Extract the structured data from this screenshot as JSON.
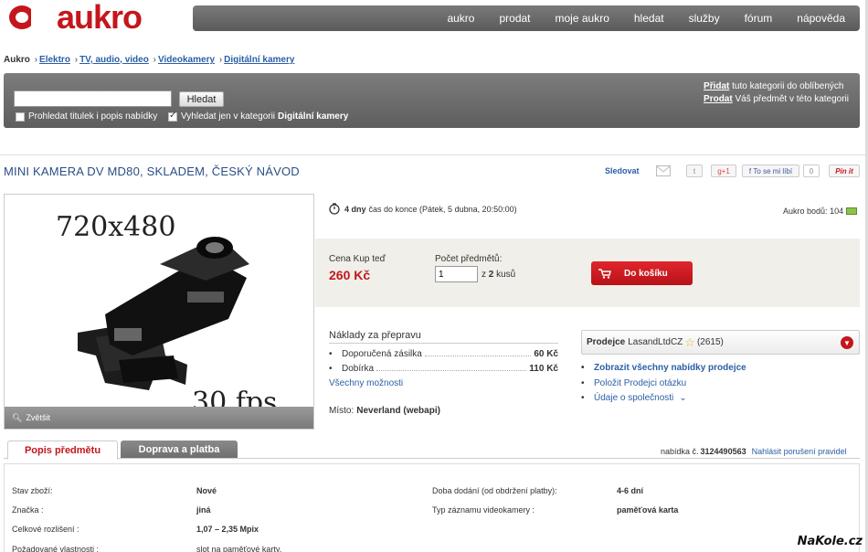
{
  "brand": {
    "logo_text": "aukro",
    "color": "#c4161c"
  },
  "topnav": [
    "aukro",
    "prodat",
    "moje aukro",
    "hledat",
    "služby",
    "fórum",
    "nápověda"
  ],
  "breadcrumb": {
    "root": "Aukro",
    "items": [
      "Elektro",
      "TV, audio, video",
      "Videokamery",
      "Digitální kamery"
    ]
  },
  "search": {
    "button": "Hledat",
    "option1": "Prohledat titulek i popis nabídky",
    "option2_prefix": "Vyhledat jen v kategorii",
    "option2_category": "Digitální kamery",
    "right_line1_link": "Přidat",
    "right_line1_text": "tuto kategorii do oblíbených",
    "right_line2_link": "Prodat",
    "right_line2_text": "Váš předmět v této kategorii"
  },
  "product": {
    "title": "MINI KAMERA DV MD80, SKLADEM, ČESKÝ NÁVOD",
    "follow": "Sledovat",
    "gplus": "+1",
    "like": "To se mi líbí",
    "like_count": "0",
    "pin": "Pin it",
    "image_text_top": "720x480",
    "image_text_bottom": "30 fps",
    "zoom": "Zvětšit"
  },
  "timer": {
    "days": "4 dny",
    "text": "čas do konce (Pátek, 5 dubna, 20:50:00)"
  },
  "points": {
    "label": "Aukro bodů:",
    "value": "104"
  },
  "buy": {
    "price_label": "Cena Kup teď",
    "price": "260 Kč",
    "qty_label": "Počet předmětů:",
    "qty_value": "1",
    "of_prefix": "z",
    "of_count": "2",
    "of_suffix": "kusů",
    "cart_button": "Do košíku"
  },
  "shipping": {
    "heading": "Náklady za přepravu",
    "rows": [
      {
        "label": "Doporučená zásilka",
        "value": "60 Kč"
      },
      {
        "label": "Dobírka",
        "value": "110 Kč"
      }
    ],
    "more": "Všechny možnosti",
    "place_label": "Místo:",
    "place_value": "Neverland (webapi)"
  },
  "seller": {
    "label": "Prodejce",
    "name": "LasandLtdCZ",
    "rating": "(2615)",
    "links": [
      "Zobrazit všechny nabídky prodejce",
      "Položit Prodejci otázku",
      "Údaje o společnosti"
    ]
  },
  "tabs": [
    "Popis předmětu",
    "Doprava a platba"
  ],
  "offer": {
    "label": "nabídka č.",
    "number": "3124490563",
    "report": "Nahlásit porušení pravidel"
  },
  "specs": [
    {
      "label": "Stav zboží:",
      "value": "Nové"
    },
    {
      "label": "Značka :",
      "value": "jiná"
    },
    {
      "label": "Celkové rozlišení :",
      "value": "1,07 – 2,35 Mpix"
    },
    {
      "label": "Požadované vlastnosti :",
      "value": "slot na paměťové karty,"
    }
  ],
  "specs_right": [
    {
      "label": "Doba dodání (od obdržení platby):",
      "value": "4-6 dní"
    },
    {
      "label": "Typ záznamu videokamery :",
      "value": "paměťová karta"
    }
  ],
  "watermark": "NaKole.cz"
}
